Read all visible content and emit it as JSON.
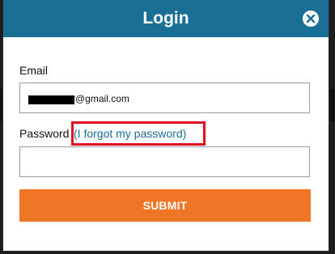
{
  "modal": {
    "title": "Login",
    "close_icon": "close-icon"
  },
  "form": {
    "email_label": "Email",
    "email_value": "r@gmail.com",
    "password_label": "Password",
    "forgot_password_link": "(I forgot my password)",
    "password_value": "",
    "submit_label": "SUBMIT"
  },
  "colors": {
    "header": "#1a6f96",
    "submit": "#f07524",
    "link": "#1a6f96",
    "highlight": "#e0111e"
  }
}
